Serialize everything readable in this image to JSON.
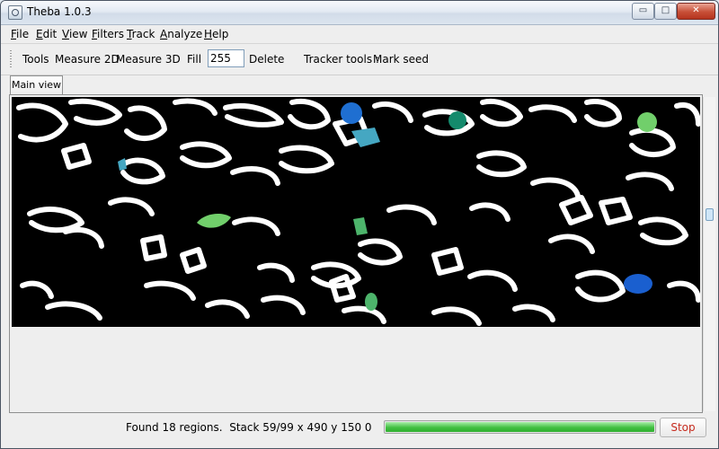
{
  "window": {
    "title": "Theba 1.0.3",
    "buttons": {
      "minimize": "▭",
      "maximize": "□",
      "close": "✕"
    }
  },
  "menu": [
    "File",
    "Edit",
    "View",
    "Filters",
    "Track",
    "Analyze",
    "Help"
  ],
  "toolbar": {
    "tools_label": "Tools",
    "measure2d": "Measure 2D",
    "measure3d": "Measure 3D",
    "fill_label": "Fill",
    "fill_value": "255",
    "delete": "Delete",
    "tracker_tools_label": "Tracker tools :",
    "mark_seed": "Mark seed"
  },
  "tabs": [
    {
      "label": "Main view",
      "selected": true
    }
  ],
  "image": {
    "background": "#000000",
    "outline_color": "#ffffff",
    "region_colors": [
      "#1f6fd1",
      "#45a7c2",
      "#148a6c",
      "#71cf6b",
      "#4db46b",
      "#1a5fcf"
    ]
  },
  "status": {
    "message": "Found 18 regions.",
    "stack": "Stack 59/99 x 490 y 150 0",
    "progress_percent": 100,
    "stop_label": "Stop"
  },
  "colors": {
    "progress_green": "#43c043",
    "stop_text": "#c62b1e",
    "titlebar": "#dce5ef"
  }
}
